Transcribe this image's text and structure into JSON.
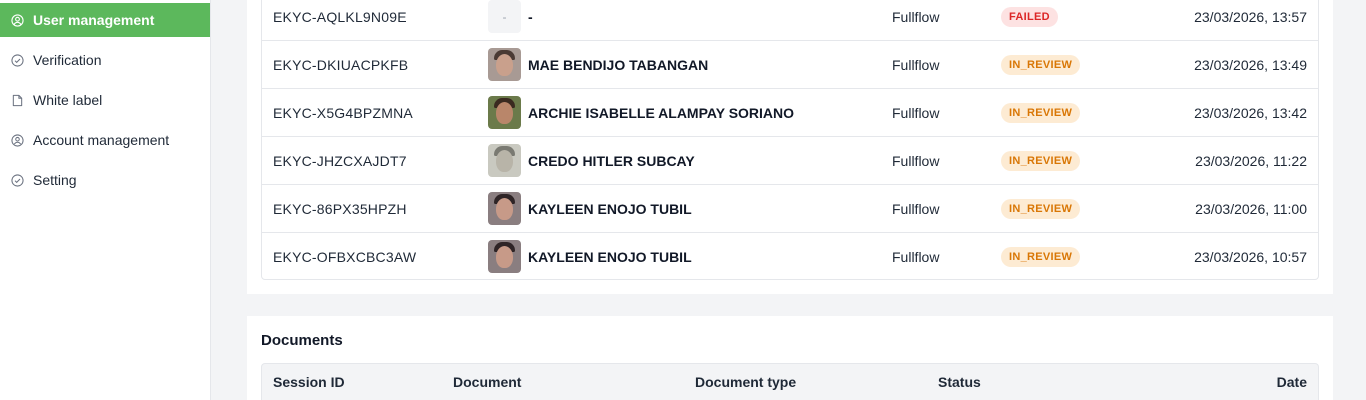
{
  "sidebar": {
    "items": [
      {
        "label": "User management",
        "icon": "user-circle-icon",
        "active": true
      },
      {
        "label": "Verification",
        "icon": "check-circle-icon",
        "active": false
      },
      {
        "label": "White label",
        "icon": "document-icon",
        "active": false
      },
      {
        "label": "Account management",
        "icon": "account-icon",
        "active": false
      },
      {
        "label": "Setting",
        "icon": "check-circle-icon",
        "active": false
      }
    ]
  },
  "sessions": {
    "rows": [
      {
        "id": "EKYC-AQLKL9N09E",
        "photo": "-",
        "name": "-",
        "flow": "Fullflow",
        "status": "FAILED",
        "date": "23/03/2026, 13:57"
      },
      {
        "id": "EKYC-DKIUACPKFB",
        "photo": "face",
        "name": "MAE BENDIJO TABANGAN",
        "flow": "Fullflow",
        "status": "IN_REVIEW",
        "date": "23/03/2026, 13:49"
      },
      {
        "id": "EKYC-X5G4BPZMNA",
        "photo": "face",
        "name": "ARCHIE ISABELLE ALAMPAY SORIANO",
        "flow": "Fullflow",
        "status": "IN_REVIEW",
        "date": "23/03/2026, 13:42"
      },
      {
        "id": "EKYC-JHZCXAJDT7",
        "photo": "face",
        "name": "CREDO HITLER SUBCAY",
        "flow": "Fullflow",
        "status": "IN_REVIEW",
        "date": "23/03/2026, 11:22"
      },
      {
        "id": "EKYC-86PX35HPZH",
        "photo": "face",
        "name": "KAYLEEN ENOJO TUBIL",
        "flow": "Fullflow",
        "status": "IN_REVIEW",
        "date": "23/03/2026, 11:00"
      },
      {
        "id": "EKYC-OFBXCBC3AW",
        "photo": "face",
        "name": "KAYLEEN ENOJO TUBIL",
        "flow": "Fullflow",
        "status": "IN_REVIEW",
        "date": "23/03/2026, 10:57"
      }
    ]
  },
  "documents": {
    "title": "Documents",
    "columns": [
      "Session ID",
      "Document",
      "Document type",
      "Status",
      "Date"
    ]
  },
  "colors": {
    "accent": "#5cb85c",
    "failed_bg": "#fde2e2",
    "failed_text": "#dc2626",
    "review_bg": "#fdebd3",
    "review_text": "#d97706"
  }
}
